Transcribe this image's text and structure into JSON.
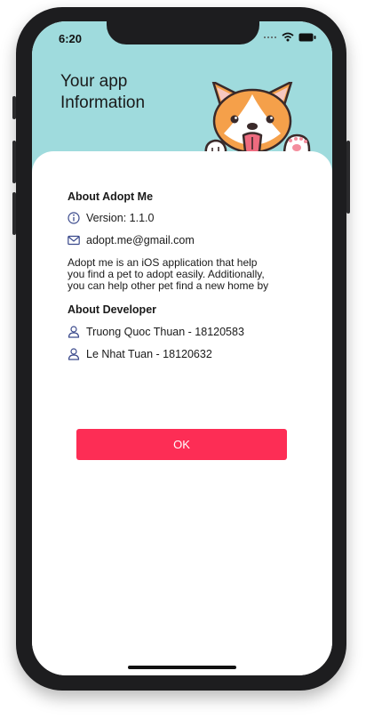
{
  "status_bar": {
    "time": "6:20"
  },
  "header": {
    "title_line1": "Your app",
    "title_line2": "Information"
  },
  "about_app": {
    "title": "About Adopt Me",
    "version": "Version: 1.1.0",
    "email": "adopt.me@gmail.com",
    "description_lines": [
      "Adopt me is an iOS application that help",
      "you find a pet to adopt easily. Additionally,",
      "you can help other pet find a new home by"
    ]
  },
  "about_developer": {
    "title": "About Developer",
    "developers": [
      "Truong Quoc Thuan - 18120583",
      "Le Nhat Tuan - 18120632"
    ]
  },
  "ok_button": {
    "label": "OK"
  },
  "colors": {
    "header_bg": "#9fdbdd",
    "accent": "#fd2d55",
    "icon": "#3b4a8c"
  },
  "icons": [
    "info-icon",
    "mail-icon",
    "person-icon",
    "wifi-icon",
    "battery-icon",
    "signal-icon"
  ]
}
